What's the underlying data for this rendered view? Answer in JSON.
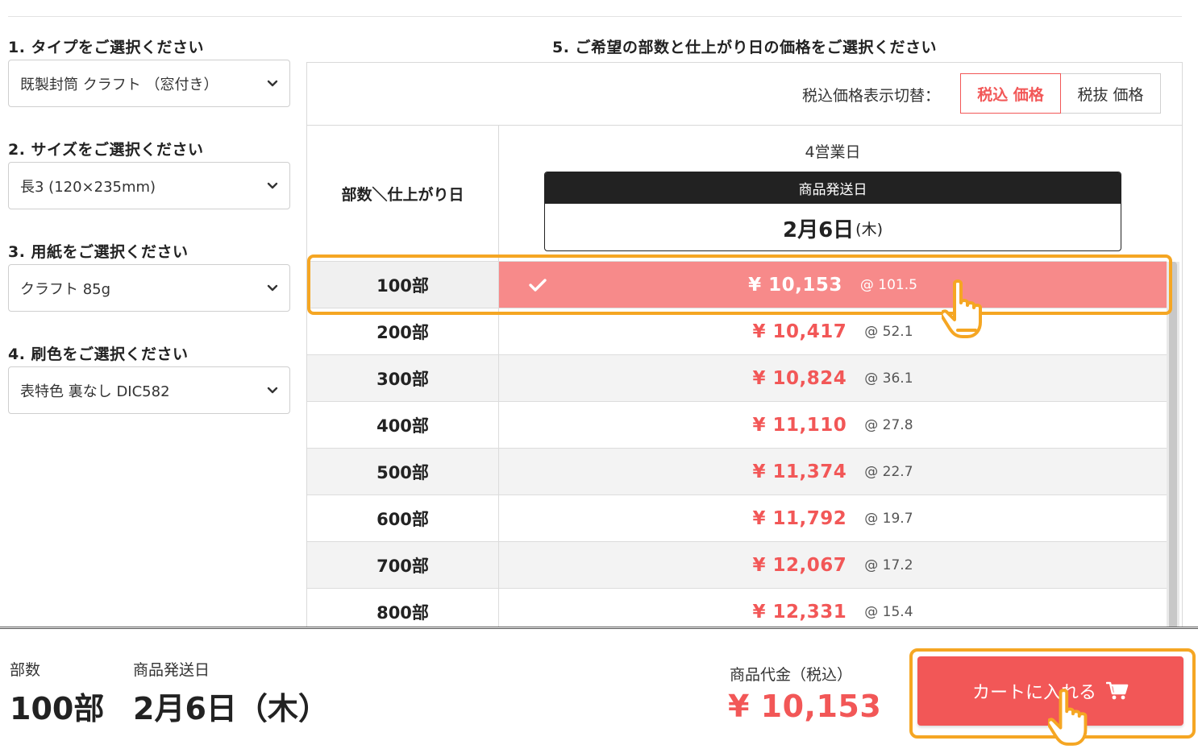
{
  "steps": [
    {
      "label": "1. タイプをご選択ください",
      "value": "既製封筒 クラフト （窓付き）"
    },
    {
      "label": "2. サイズをご選択ください",
      "value": "長3 (120×235mm)"
    },
    {
      "label": "3. 用紙をご選択ください",
      "value": "クラフト 85g"
    },
    {
      "label": "4. 刷色をご選択ください",
      "value": "表特色 裏なし DIC582"
    }
  ],
  "price_table": {
    "title": "5. ご希望の部数と仕上がり日の価格をご選択ください",
    "tax_toggle_label": "税込価格表示切替：",
    "tax_included": "税込 価格",
    "tax_excluded": "税抜 価格",
    "header_left": "部数＼仕上がり日",
    "days": "4営業日",
    "ship_label": "商品発送日",
    "ship_date": "2月6日",
    "ship_dow": "(木)",
    "rows": [
      {
        "qty": "100部",
        "price": "¥ 10,153",
        "unit": "@ 101.5",
        "selected": true
      },
      {
        "qty": "200部",
        "price": "¥ 10,417",
        "unit": "@ 52.1"
      },
      {
        "qty": "300部",
        "price": "¥ 10,824",
        "unit": "@ 36.1"
      },
      {
        "qty": "400部",
        "price": "¥ 11,110",
        "unit": "@ 27.8"
      },
      {
        "qty": "500部",
        "price": "¥ 11,374",
        "unit": "@ 22.7"
      },
      {
        "qty": "600部",
        "price": "¥ 11,792",
        "unit": "@ 19.7"
      },
      {
        "qty": "700部",
        "price": "¥ 12,067",
        "unit": "@ 17.2"
      },
      {
        "qty": "800部",
        "price": "¥ 12,331",
        "unit": "@ 15.4"
      }
    ]
  },
  "summary": {
    "qty_label": "部数",
    "qty": "100部",
    "ship_label": "商品発送日",
    "ship": "2月6日（木）",
    "total_label": "商品代金（税込）",
    "total": "¥ 10,153",
    "cart_label": "カートに入れる"
  },
  "colors": {
    "accent": "#f25757",
    "selected_row": "#f78a8a",
    "highlight": "#f5a623"
  },
  "icons": [
    "chevron-down-icon",
    "check-icon",
    "cart-icon",
    "pointer-hand-icon"
  ]
}
